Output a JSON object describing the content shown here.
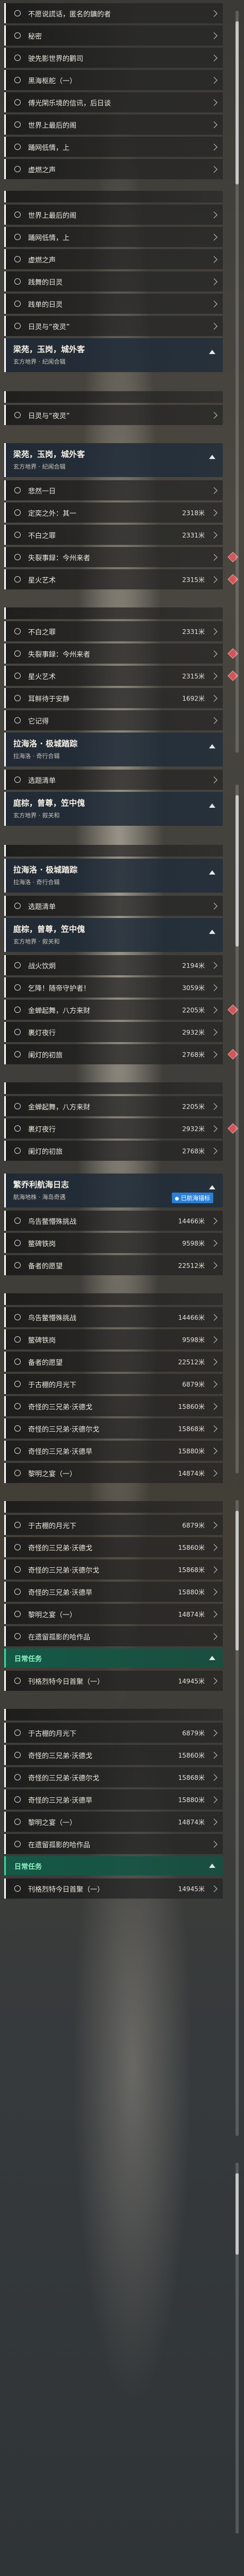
{
  "groups": [
    {
      "top": 0,
      "items": [
        {
          "label": "不愿说謊话，匿名的鑛的者"
        },
        {
          "label": "秘密"
        },
        {
          "label": "驶先影世界的鹳司"
        },
        {
          "label": "黑海枢舵（一）"
        },
        {
          "label": "傅光閑乐境的信讯，后日谈"
        },
        {
          "label": "世界上最后的阁"
        },
        {
          "label": "踊网低情，上"
        },
        {
          "label": "虚燃之声"
        }
      ]
    },
    {
      "top": 0,
      "items": [
        {
          "label": "世界上最后的阁"
        },
        {
          "label": "踊网低情，上"
        },
        {
          "label": "虚燃之声"
        },
        {
          "label": "践舞的日灵"
        },
        {
          "label": "践单的日灵"
        },
        {
          "label": "日灵与“夜灵”"
        }
      ]
    }
  ],
  "headers": {
    "liang1": {
      "title": "梁苑，玉岗，城外客",
      "subtitle": "玄方地界 · 纪闻合辑"
    },
    "liang2": {
      "title": "梁苑，玉岗，城外客",
      "subtitle": "玄方地界 · 纪闻合辑"
    },
    "lahai1": {
      "title": "拉海洛 · 极城踏踪",
      "subtitle": "拉海洛 · 奇行合辑"
    },
    "tingxu1": {
      "title": "庭棕，曾尊，笠中傀",
      "subtitle": "玄方地界 · 叙关和"
    },
    "lahai2": {
      "title": "拉海洛 · 极城踏踪",
      "subtitle": "拉海洛 · 奇行合辑"
    },
    "tingxu2": {
      "title": "庭棕，曾尊，笠中傀",
      "subtitle": "玄方地界 · 叙关和"
    },
    "jingqiao": {
      "title": "繁乔利航海日志",
      "subtitle": "航海地株 · 海岛奇遇"
    }
  },
  "rows_a": [
    {
      "label": "日灵与“夜灵”",
      "dist": ""
    }
  ],
  "rows_b": [
    {
      "label": "悲然一日",
      "dist": ""
    },
    {
      "label": "定奕之外：其一",
      "dist": "2318米"
    },
    {
      "label": "不白之罪",
      "dist": "2331米"
    },
    {
      "label": "失裂事録：今州来者",
      "dist": ""
    },
    {
      "label": "星火艺术",
      "dist": "2315米"
    }
  ],
  "rows_c": [
    {
      "label": "不白之罪",
      "dist": "2331米"
    },
    {
      "label": "失裂事録：今州来者",
      "dist": ""
    },
    {
      "label": "星火艺术",
      "dist": "2315米"
    },
    {
      "label": "耳鲜待于安静",
      "dist": "1692米"
    },
    {
      "label": "它记得",
      "dist": ""
    }
  ],
  "rows_d": [
    {
      "label": "选题清单",
      "dist": ""
    }
  ],
  "rows_e": [
    {
      "label": "选题清单",
      "dist": ""
    }
  ],
  "rows_f": [
    {
      "label": "战火饮炯",
      "dist": "2194米"
    },
    {
      "label": "乞降！随帝守护者！",
      "dist": "3059米"
    },
    {
      "label": "金蝉起舞，八方来财",
      "dist": "2205米"
    },
    {
      "label": "裹灯夜行",
      "dist": "2932米"
    },
    {
      "label": "阑灯的初旅",
      "dist": "2768米"
    }
  ],
  "rows_g": [
    {
      "label": "金蝉起舞，八方来财",
      "dist": "2205米"
    },
    {
      "label": "裹灯夜行",
      "dist": "2932米"
    },
    {
      "label": "阑灯的初旅",
      "dist": "2768米"
    }
  ],
  "tag_label": "已航海锚标",
  "rows_h": [
    {
      "label": "鸟告鳖懵殊挑战",
      "dist": "14466米"
    },
    {
      "label": "鳖碑铁岗",
      "dist": "9598米"
    },
    {
      "label": "备者的愿望",
      "dist": "22512米"
    }
  ],
  "rows_i": [
    {
      "label": "鸟告鳖懵殊挑战",
      "dist": "14466米"
    },
    {
      "label": "鳖碑铁岗",
      "dist": "9598米"
    },
    {
      "label": "备者的愿望",
      "dist": "22512米"
    },
    {
      "label": "于古棚的月光下",
      "dist": "6879米"
    },
    {
      "label": "奇怪的三兄弟·沃德戈",
      "dist": "15860米"
    },
    {
      "label": "奇怪的三兄弟·沃德尔戈",
      "dist": "15868米"
    },
    {
      "label": "奇怪的三兄弟·沃德旱",
      "dist": "15880米"
    },
    {
      "label": "黎明之宴（一）",
      "dist": "14874米"
    }
  ],
  "rows_j": [
    {
      "label": "于古棚的月光下",
      "dist": "6879米"
    },
    {
      "label": "奇怪的三兄弟·沃德戈",
      "dist": "15860米"
    },
    {
      "label": "奇怪的三兄弟·沃德尔戈",
      "dist": "15868米"
    },
    {
      "label": "奇怪的三兄弟·沃德旱",
      "dist": "15880米"
    },
    {
      "label": "黎明之宴（一）",
      "dist": "14874米"
    },
    {
      "label": "在遗留孤影的哈作品",
      "dist": ""
    }
  ],
  "section_daily": "日常任务",
  "rows_k": [
    {
      "label": "刊格烈特今日首聚（一）",
      "dist": "14945米"
    }
  ],
  "rows_l": [
    {
      "label": "于古棚的月光下",
      "dist": "6879米"
    },
    {
      "label": "奇怪的三兄弟·沃德戈",
      "dist": "15860米"
    },
    {
      "label": "奇怪的三兄弟·沃德尔戈",
      "dist": "15868米"
    },
    {
      "label": "奇怪的三兄弟·沃德旱",
      "dist": "15880米"
    },
    {
      "label": "黎明之宴（一）",
      "dist": "14874米"
    },
    {
      "label": "在遗留孤影的哈作品",
      "dist": ""
    }
  ],
  "section_daily2": "日常任务",
  "rows_m": [
    {
      "label": "刊格烈特今日首聚（一）",
      "dist": "14945米"
    }
  ]
}
